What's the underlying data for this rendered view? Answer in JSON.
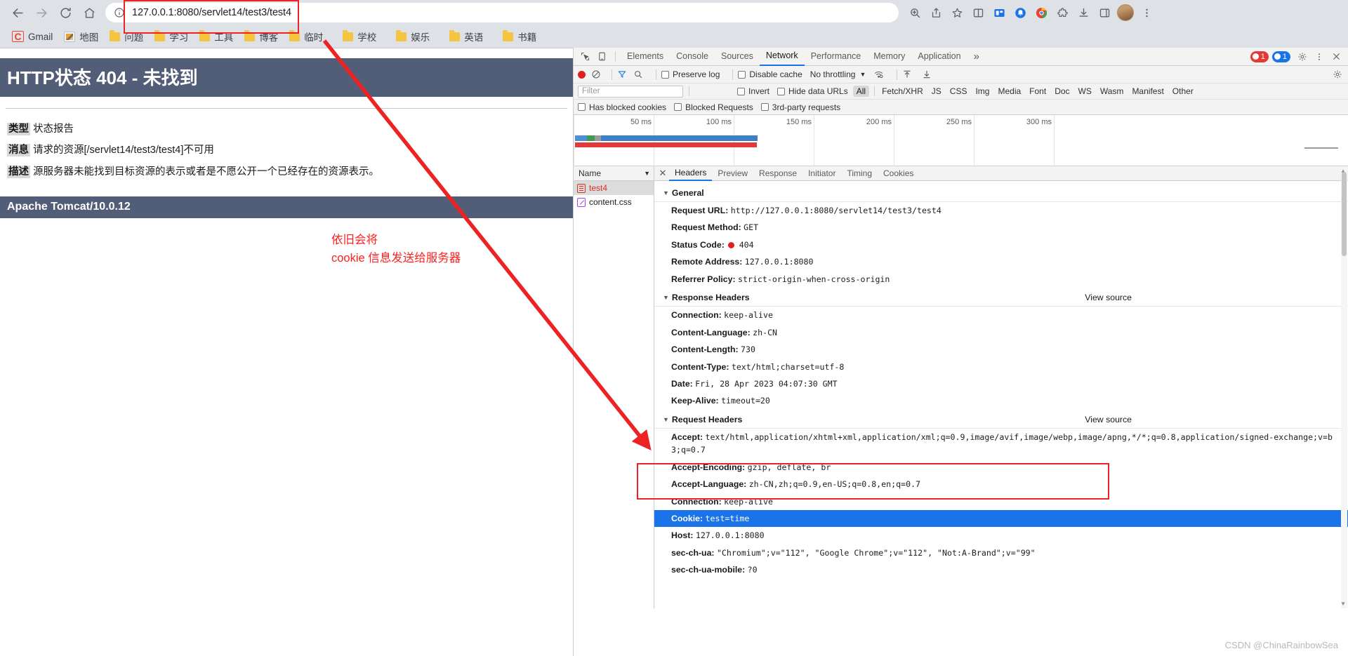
{
  "browser": {
    "nav": {
      "back": "back-arrow",
      "forward": "forward-arrow",
      "reload": "reload",
      "home": "home"
    },
    "omnibox": {
      "url": "127.0.0.1:8080/servlet14/test3/test4",
      "info_icon": "info-circle-icon"
    },
    "toolbar_icons": [
      "zoom-icon",
      "share-icon",
      "bookmark-star-icon",
      "split-screen-icon",
      "extension-chip-icon",
      "notification-bell-icon",
      "chrome-circle-icon",
      "puzzle-extensions-icon",
      "download-icon",
      "side-panel-icon"
    ],
    "bookmarks": [
      {
        "label": "Gmail",
        "icon": "gmail-icon"
      },
      {
        "label": "地图",
        "icon": "map-icon"
      },
      {
        "label": "问题",
        "icon": "folder-icon"
      },
      {
        "label": "学习",
        "icon": "folder-icon"
      },
      {
        "label": "工具",
        "icon": "folder-icon"
      },
      {
        "label": "博客",
        "icon": "folder-icon"
      },
      {
        "label": "临时",
        "icon": "folder-icon"
      },
      {
        "label": "学校",
        "icon": "folder-icon"
      },
      {
        "label": "娱乐",
        "icon": "folder-icon"
      },
      {
        "label": "英语",
        "icon": "folder-icon"
      },
      {
        "label": "书籍",
        "icon": "folder-icon"
      }
    ]
  },
  "page": {
    "title": "HTTP状态 404 - 未找到",
    "rows": [
      {
        "key": "类型",
        "value": "状态报告"
      },
      {
        "key": "消息",
        "value": "请求的资源[/servlet14/test3/test4]不可用"
      },
      {
        "key": "描述",
        "value": "源服务器未能找到目标资源的表示或者是不愿公开一个已经存在的资源表示。"
      }
    ],
    "footer": "Apache Tomcat/10.0.12"
  },
  "annotations": {
    "note_line1": "依旧会将",
    "note_line2": "cookie 信息发送给服务器",
    "accent_color": "#ee2222"
  },
  "devtools": {
    "tabs": [
      {
        "label": "Elements",
        "active": false
      },
      {
        "label": "Console",
        "active": false
      },
      {
        "label": "Sources",
        "active": false
      },
      {
        "label": "Network",
        "active": true
      },
      {
        "label": "Performance",
        "active": false
      },
      {
        "label": "Memory",
        "active": false
      },
      {
        "label": "Application",
        "active": false
      }
    ],
    "more_tabs": "»",
    "badges": {
      "errors": "1",
      "info": "1"
    },
    "right_icons": [
      "settings-gear-icon",
      "more-vertical-icon",
      "close-icon"
    ],
    "network_bar": {
      "record": "record-button",
      "clear": "clear-button",
      "filter_icon": "funnel-icon",
      "search_icon": "search-icon",
      "preserve_log": "Preserve log",
      "disable_cache": "Disable cache",
      "throttling": "No throttling",
      "throttle_caret": "▼",
      "wifi_icon": "network-conditions-icon",
      "import_icon": "import-har-icon",
      "export_icon": "export-har-icon",
      "settings_icon": "settings-gear-icon"
    },
    "filter_bar": {
      "placeholder": "Filter",
      "invert": "Invert",
      "hide_data_urls": "Hide data URLs",
      "types": [
        "All",
        "Fetch/XHR",
        "JS",
        "CSS",
        "Img",
        "Media",
        "Font",
        "Doc",
        "WS",
        "Wasm",
        "Manifest",
        "Other"
      ],
      "selected_type": "All"
    },
    "filter_bar2": {
      "has_blocked_cookies": "Has blocked cookies",
      "blocked_requests": "Blocked Requests",
      "third_party": "3rd-party requests"
    },
    "timeline_ticks": [
      "50 ms",
      "100 ms",
      "150 ms",
      "200 ms",
      "250 ms",
      "300 ms"
    ],
    "request_list": {
      "column": "Name",
      "sort_caret": "▼",
      "rows": [
        {
          "name": "test4",
          "type": "doc",
          "selected": true
        },
        {
          "name": "content.css",
          "type": "css",
          "selected": false
        }
      ]
    },
    "detail_tabs": [
      {
        "label": "Headers",
        "active": true
      },
      {
        "label": "Preview",
        "active": false
      },
      {
        "label": "Response",
        "active": false
      },
      {
        "label": "Initiator",
        "active": false
      },
      {
        "label": "Timing",
        "active": false
      },
      {
        "label": "Cookies",
        "active": false
      }
    ],
    "sections": [
      {
        "title": "General",
        "view_source": "",
        "rows": [
          {
            "name": "Request URL:",
            "value": "http://127.0.0.1:8080/servlet14/test3/test4"
          },
          {
            "name": "Request Method:",
            "value": "GET"
          },
          {
            "name": "Status Code:",
            "value": "404",
            "status": true
          },
          {
            "name": "Remote Address:",
            "value": "127.0.0.1:8080"
          },
          {
            "name": "Referrer Policy:",
            "value": "strict-origin-when-cross-origin"
          }
        ]
      },
      {
        "title": "Response Headers",
        "view_source": "View source",
        "rows": [
          {
            "name": "Connection:",
            "value": "keep-alive"
          },
          {
            "name": "Content-Language:",
            "value": "zh-CN"
          },
          {
            "name": "Content-Length:",
            "value": "730"
          },
          {
            "name": "Content-Type:",
            "value": "text/html;charset=utf-8"
          },
          {
            "name": "Date:",
            "value": "Fri, 28 Apr 2023 04:07:30 GMT"
          },
          {
            "name": "Keep-Alive:",
            "value": "timeout=20"
          }
        ]
      },
      {
        "title": "Request Headers",
        "view_source": "View source",
        "rows": [
          {
            "name": "Accept:",
            "value": "text/html,application/xhtml+xml,application/xml;q=0.9,image/avif,image/webp,image/apng,*/*;q=0.8,application/signed-exchange;v=b3;q=0.7"
          },
          {
            "name": "Accept-Encoding:",
            "value": "gzip, deflate, br"
          },
          {
            "name": "Accept-Language:",
            "value": "zh-CN,zh;q=0.9,en-US;q=0.8,en;q=0.7"
          },
          {
            "name": "Connection:",
            "value": "keep-alive"
          },
          {
            "name": "Cookie:",
            "value": "test=time",
            "selected": true
          },
          {
            "name": "Host:",
            "value": "127.0.0.1:8080"
          },
          {
            "name": "sec-ch-ua:",
            "value": "\"Chromium\";v=\"112\", \"Google Chrome\";v=\"112\", \"Not:A-Brand\";v=\"99\""
          },
          {
            "name": "sec-ch-ua-mobile:",
            "value": "?0"
          }
        ]
      }
    ]
  },
  "watermark": "CSDN @ChinaRainbowSea"
}
